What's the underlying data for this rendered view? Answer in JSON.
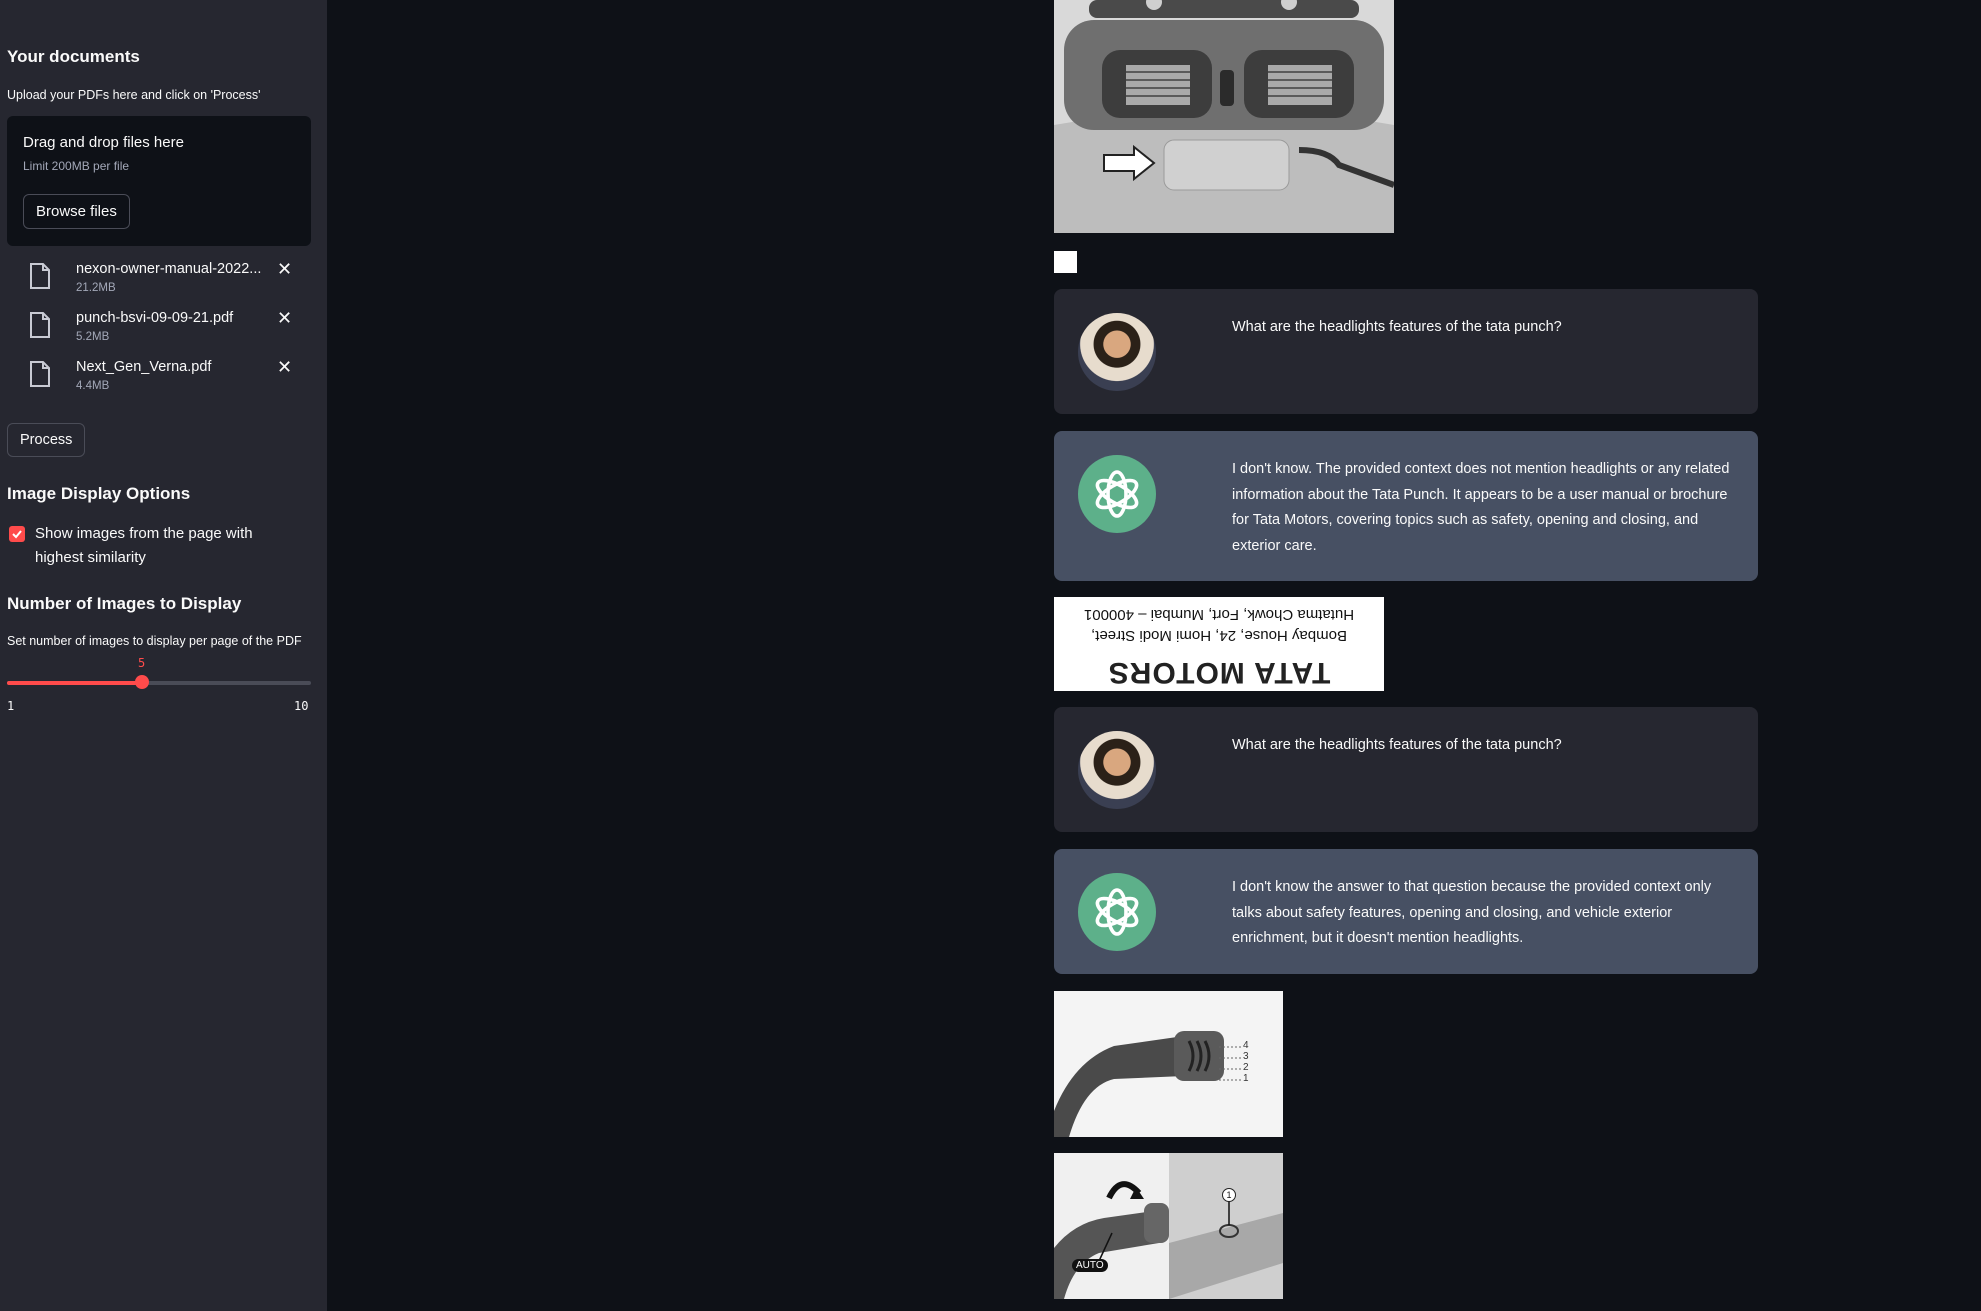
{
  "sidebar": {
    "heading": "Your documents",
    "subtext": "Upload your PDFs here and click on 'Process'",
    "dropzone": {
      "title": "Drag and drop files here",
      "limit": "Limit 200MB per file",
      "browse_label": "Browse files"
    },
    "files": [
      {
        "name": "nexon-owner-manual-2022...",
        "size": "21.2MB"
      },
      {
        "name": "punch-bsvi-09-09-21.pdf",
        "size": "5.2MB"
      },
      {
        "name": "Next_Gen_Verna.pdf",
        "size": "4.4MB"
      }
    ],
    "process_label": "Process",
    "image_options_heading": "Image Display Options",
    "show_images_label": "Show images from the page with highest similarity",
    "show_images_checked": true,
    "num_images_heading": "Number of Images to Display",
    "num_images_subtext": "Set number of images to display per page of the PDF",
    "slider": {
      "value": "5",
      "min": "1",
      "max": "10",
      "fraction": 0.444
    }
  },
  "chat": [
    {
      "role": "user",
      "text": "What are the headlights features of the tata punch?"
    },
    {
      "role": "assistant",
      "text": "I don't know. The provided context does not mention headlights or any related information about the Tata Punch. It appears to be a user manual or brochure for Tata Motors, covering topics such as safety, opening and closing, and exterior care."
    },
    {
      "role": "user",
      "text": "What are the headlights features of the tata punch?"
    },
    {
      "role": "assistant",
      "text": "I don't know the answer to that question because the provided context only talks about safety features, opening and closing, and vehicle exterior enrichment, but it doesn't mention headlights."
    }
  ],
  "images": {
    "tata_lines": [
      "Bombay House, 24, Homi Modi Street,",
      "Hutatma Chowk, Fort, Mumbai – 400001",
      "TATA MOTORS"
    ],
    "stalk_numbers": [
      "4",
      "3",
      "2",
      "1"
    ],
    "auto_label": "AUTO",
    "marker_label": "1"
  },
  "colors": {
    "accent": "#ff4b4b",
    "sidebar_bg": "#262730",
    "main_bg": "#0e1117",
    "bot_bg": "#475063",
    "openai_green": "#5db08a"
  }
}
